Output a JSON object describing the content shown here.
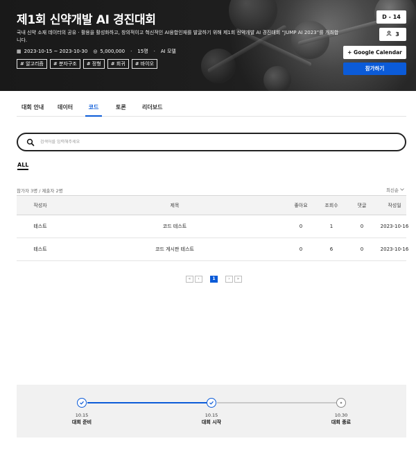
{
  "hero": {
    "title": "제1회 신약개발 AI 경진대회",
    "description": "국내 신약 소재 데이터의 공유 · 활용을 활성화하고, 창의적이고 혁신적인 AI융합인재를 발굴하기 위해 제1회 신약개발 AI 경진대회 “JUMP AI 2023”를 개최합니다.",
    "period": "2023-10-15 ~ 2023-10-30",
    "prize": "5,000,000",
    "teams": "15명",
    "category": "AI 모델",
    "tags": [
      "# 알고리즘",
      "# 분자구조",
      "# 정형",
      "# 회귀",
      "# 바이오"
    ],
    "dday": "D - 14",
    "participants": "3",
    "calendar_button": "+ Google Calendar",
    "join_button": "참가하기"
  },
  "tabs": [
    {
      "label": "대회 안내",
      "active": false
    },
    {
      "label": "데이터",
      "active": false
    },
    {
      "label": "코드",
      "active": true
    },
    {
      "label": "토론",
      "active": false
    },
    {
      "label": "리더보드",
      "active": false
    }
  ],
  "search": {
    "placeholder": "검색어를 입력해주세요"
  },
  "filter": {
    "all_label": "ALL"
  },
  "summary": {
    "count_text": "참가자 3명 / 제출자 2명",
    "sort_label": "최신순"
  },
  "table": {
    "headers": {
      "author": "작성자",
      "title": "제목",
      "likes": "좋아요",
      "views": "조회수",
      "comments": "댓글",
      "date": "작성일"
    },
    "rows": [
      {
        "author": "테스트",
        "title": "코드 테스트",
        "likes": "0",
        "views": "1",
        "comments": "0",
        "date": "2023-10-16"
      },
      {
        "author": "테스트",
        "title": "코드 게시판 테스트",
        "likes": "0",
        "views": "6",
        "comments": "0",
        "date": "2023-10-16"
      }
    ]
  },
  "pagination": {
    "current": "1",
    "first": "«",
    "prev": "‹",
    "next": "›",
    "last": "»"
  },
  "timeline": {
    "steps": [
      {
        "date": "10.15",
        "label": "대회 준비",
        "status": "done"
      },
      {
        "date": "10.15",
        "label": "대회 시작",
        "status": "done"
      },
      {
        "date": "10.30",
        "label": "대회 종료",
        "status": "pending"
      }
    ]
  },
  "colors": {
    "accent": "#0b5bd8",
    "pending": "#888888"
  }
}
